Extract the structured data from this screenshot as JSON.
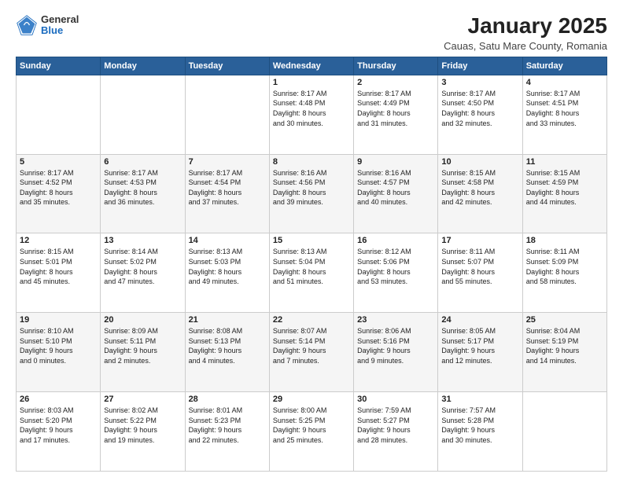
{
  "logo": {
    "general": "General",
    "blue": "Blue"
  },
  "header": {
    "title": "January 2025",
    "subtitle": "Cauas, Satu Mare County, Romania"
  },
  "weekdays": [
    "Sunday",
    "Monday",
    "Tuesday",
    "Wednesday",
    "Thursday",
    "Friday",
    "Saturday"
  ],
  "weeks": [
    [
      {
        "day": "",
        "info": ""
      },
      {
        "day": "",
        "info": ""
      },
      {
        "day": "",
        "info": ""
      },
      {
        "day": "1",
        "info": "Sunrise: 8:17 AM\nSunset: 4:48 PM\nDaylight: 8 hours\nand 30 minutes."
      },
      {
        "day": "2",
        "info": "Sunrise: 8:17 AM\nSunset: 4:49 PM\nDaylight: 8 hours\nand 31 minutes."
      },
      {
        "day": "3",
        "info": "Sunrise: 8:17 AM\nSunset: 4:50 PM\nDaylight: 8 hours\nand 32 minutes."
      },
      {
        "day": "4",
        "info": "Sunrise: 8:17 AM\nSunset: 4:51 PM\nDaylight: 8 hours\nand 33 minutes."
      }
    ],
    [
      {
        "day": "5",
        "info": "Sunrise: 8:17 AM\nSunset: 4:52 PM\nDaylight: 8 hours\nand 35 minutes."
      },
      {
        "day": "6",
        "info": "Sunrise: 8:17 AM\nSunset: 4:53 PM\nDaylight: 8 hours\nand 36 minutes."
      },
      {
        "day": "7",
        "info": "Sunrise: 8:17 AM\nSunset: 4:54 PM\nDaylight: 8 hours\nand 37 minutes."
      },
      {
        "day": "8",
        "info": "Sunrise: 8:16 AM\nSunset: 4:56 PM\nDaylight: 8 hours\nand 39 minutes."
      },
      {
        "day": "9",
        "info": "Sunrise: 8:16 AM\nSunset: 4:57 PM\nDaylight: 8 hours\nand 40 minutes."
      },
      {
        "day": "10",
        "info": "Sunrise: 8:15 AM\nSunset: 4:58 PM\nDaylight: 8 hours\nand 42 minutes."
      },
      {
        "day": "11",
        "info": "Sunrise: 8:15 AM\nSunset: 4:59 PM\nDaylight: 8 hours\nand 44 minutes."
      }
    ],
    [
      {
        "day": "12",
        "info": "Sunrise: 8:15 AM\nSunset: 5:01 PM\nDaylight: 8 hours\nand 45 minutes."
      },
      {
        "day": "13",
        "info": "Sunrise: 8:14 AM\nSunset: 5:02 PM\nDaylight: 8 hours\nand 47 minutes."
      },
      {
        "day": "14",
        "info": "Sunrise: 8:13 AM\nSunset: 5:03 PM\nDaylight: 8 hours\nand 49 minutes."
      },
      {
        "day": "15",
        "info": "Sunrise: 8:13 AM\nSunset: 5:04 PM\nDaylight: 8 hours\nand 51 minutes."
      },
      {
        "day": "16",
        "info": "Sunrise: 8:12 AM\nSunset: 5:06 PM\nDaylight: 8 hours\nand 53 minutes."
      },
      {
        "day": "17",
        "info": "Sunrise: 8:11 AM\nSunset: 5:07 PM\nDaylight: 8 hours\nand 55 minutes."
      },
      {
        "day": "18",
        "info": "Sunrise: 8:11 AM\nSunset: 5:09 PM\nDaylight: 8 hours\nand 58 minutes."
      }
    ],
    [
      {
        "day": "19",
        "info": "Sunrise: 8:10 AM\nSunset: 5:10 PM\nDaylight: 9 hours\nand 0 minutes."
      },
      {
        "day": "20",
        "info": "Sunrise: 8:09 AM\nSunset: 5:11 PM\nDaylight: 9 hours\nand 2 minutes."
      },
      {
        "day": "21",
        "info": "Sunrise: 8:08 AM\nSunset: 5:13 PM\nDaylight: 9 hours\nand 4 minutes."
      },
      {
        "day": "22",
        "info": "Sunrise: 8:07 AM\nSunset: 5:14 PM\nDaylight: 9 hours\nand 7 minutes."
      },
      {
        "day": "23",
        "info": "Sunrise: 8:06 AM\nSunset: 5:16 PM\nDaylight: 9 hours\nand 9 minutes."
      },
      {
        "day": "24",
        "info": "Sunrise: 8:05 AM\nSunset: 5:17 PM\nDaylight: 9 hours\nand 12 minutes."
      },
      {
        "day": "25",
        "info": "Sunrise: 8:04 AM\nSunset: 5:19 PM\nDaylight: 9 hours\nand 14 minutes."
      }
    ],
    [
      {
        "day": "26",
        "info": "Sunrise: 8:03 AM\nSunset: 5:20 PM\nDaylight: 9 hours\nand 17 minutes."
      },
      {
        "day": "27",
        "info": "Sunrise: 8:02 AM\nSunset: 5:22 PM\nDaylight: 9 hours\nand 19 minutes."
      },
      {
        "day": "28",
        "info": "Sunrise: 8:01 AM\nSunset: 5:23 PM\nDaylight: 9 hours\nand 22 minutes."
      },
      {
        "day": "29",
        "info": "Sunrise: 8:00 AM\nSunset: 5:25 PM\nDaylight: 9 hours\nand 25 minutes."
      },
      {
        "day": "30",
        "info": "Sunrise: 7:59 AM\nSunset: 5:27 PM\nDaylight: 9 hours\nand 28 minutes."
      },
      {
        "day": "31",
        "info": "Sunrise: 7:57 AM\nSunset: 5:28 PM\nDaylight: 9 hours\nand 30 minutes."
      },
      {
        "day": "",
        "info": ""
      }
    ]
  ]
}
